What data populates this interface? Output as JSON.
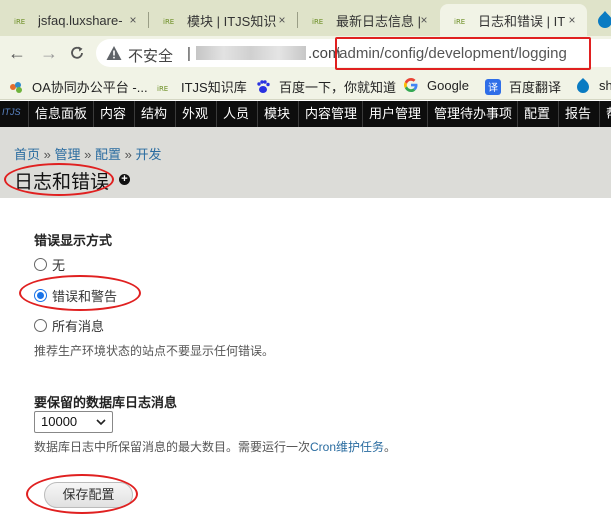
{
  "browser": {
    "tabs": [
      {
        "label": "jsfaq.luxshare-",
        "active": false
      },
      {
        "label": "模块 | ITJS知识",
        "active": false
      },
      {
        "label": "最新日志信息 |",
        "active": false
      },
      {
        "label": "日志和错误 | IT",
        "active": true
      }
    ],
    "tab_close": "×",
    "back": "←",
    "forward": "→",
    "address": {
      "insecure_label": "不安全",
      "separator": "|",
      "domain_suffix": ".com",
      "path": "/admin/config/development/logging"
    },
    "bookmarks": [
      {
        "label": "OA协同办公平台 -...",
        "icon": "oa-icon"
      },
      {
        "label": "ITJS知识库",
        "icon": "itjs-icon"
      },
      {
        "label": "百度一下，你就知道",
        "icon": "baidu-icon"
      },
      {
        "label": "Google",
        "icon": "google-icon"
      },
      {
        "label": "百度翻译",
        "icon": "baidu-translate-icon"
      },
      {
        "label": "sh",
        "icon": "drupal-icon"
      }
    ]
  },
  "admin_menu": {
    "logo": "ITJS",
    "items": [
      "信息面板",
      "内容",
      "结构",
      "外观",
      "人员",
      "模块",
      "内容管理",
      "用户管理",
      "管理待办事项",
      "配置",
      "报告",
      "帮"
    ]
  },
  "header": {
    "breadcrumb": [
      "首页",
      "管理",
      "配置",
      "开发"
    ],
    "breadcrumb_sep": "»",
    "title": "日志和错误",
    "add_shortcut": "+"
  },
  "form": {
    "error_display": {
      "label": "错误显示方式",
      "options": [
        {
          "label": "无",
          "checked": false
        },
        {
          "label": "错误和警告",
          "checked": true
        },
        {
          "label": "所有消息",
          "checked": false
        }
      ],
      "description": "推荐生产环境状态的站点不要显示任何错误。"
    },
    "row_limit": {
      "label": "要保留的数据库日志消息",
      "value": "10000",
      "description_prefix": "数据库日志中所保留消息的最大数目。需要运行一次",
      "description_link": "Cron维护任务",
      "description_suffix": "。"
    },
    "save_label": "保存配置"
  },
  "colors": {
    "annotation": "#e02020",
    "link": "#2a6ca0",
    "admin_bar": "#0d0d0d",
    "radio_selected": "#1a73e8"
  }
}
